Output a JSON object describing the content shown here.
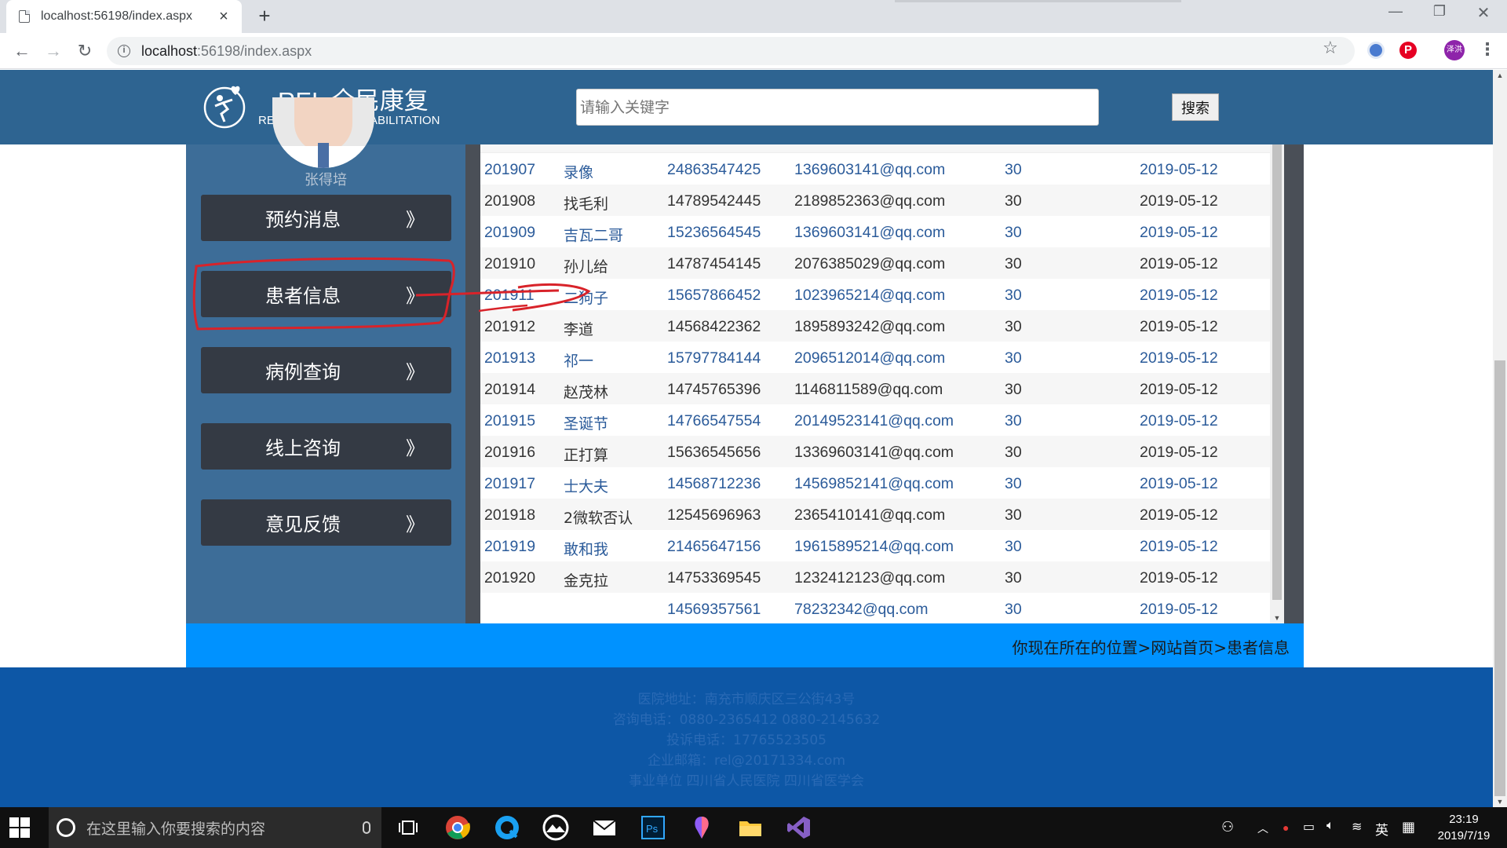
{
  "browser": {
    "tab_title": "localhost:56198/index.aspx",
    "tab_close": "×",
    "new_tab": "+",
    "url_host": "localhost",
    "url_path": ":56198/index.aspx",
    "window_min": "—",
    "window_max": "❐",
    "window_close": "✕",
    "profile_initials": "泽洪"
  },
  "header": {
    "title": "REL 全民康复",
    "subtitle": "REL NATIONAL REHABILITATION",
    "search_placeholder": "请输入关键字",
    "search_button": "搜索",
    "bg_color": "#2e6491"
  },
  "sidebar": {
    "username": "张得培",
    "chevron": "》",
    "items": [
      {
        "label": "预约消息"
      },
      {
        "label": "患者信息"
      },
      {
        "label": "病例查询"
      },
      {
        "label": "线上咨询"
      },
      {
        "label": "意见反馈"
      }
    ]
  },
  "table": {
    "rows": [
      {
        "id": "201907",
        "name": "录像",
        "phone": "24863547425",
        "email": "1369603141@qq.com",
        "age": "30",
        "date": "2019-05-12"
      },
      {
        "id": "201908",
        "name": "找毛利",
        "phone": "14789542445",
        "email": "2189852363@qq.com",
        "age": "30",
        "date": "2019-05-12"
      },
      {
        "id": "201909",
        "name": "吉瓦二哥",
        "phone": "15236564545",
        "email": "1369603141@qq.com",
        "age": "30",
        "date": "2019-05-12"
      },
      {
        "id": "201910",
        "name": "孙儿给",
        "phone": "14787454145",
        "email": "2076385029@qq.com",
        "age": "30",
        "date": "2019-05-12"
      },
      {
        "id": "201911",
        "name": "二狗子",
        "phone": "15657866452",
        "email": "1023965214@qq.com",
        "age": "30",
        "date": "2019-05-12"
      },
      {
        "id": "201912",
        "name": "李道",
        "phone": "14568422362",
        "email": "1895893242@qq.com",
        "age": "30",
        "date": "2019-05-12"
      },
      {
        "id": "201913",
        "name": "祁一",
        "phone": "15797784144",
        "email": "2096512014@qq.com",
        "age": "30",
        "date": "2019-05-12"
      },
      {
        "id": "201914",
        "name": "赵茂林",
        "phone": "14745765396",
        "email": "1146811589@qq.com",
        "age": "30",
        "date": "2019-05-12"
      },
      {
        "id": "201915",
        "name": "圣诞节",
        "phone": "14766547554",
        "email": "20149523141@qq.com",
        "age": "30",
        "date": "2019-05-12"
      },
      {
        "id": "201916",
        "name": "正打算",
        "phone": "15636545656",
        "email": "13369603141@qq.com",
        "age": "30",
        "date": "2019-05-12"
      },
      {
        "id": "201917",
        "name": "士大夫",
        "phone": "14568712236",
        "email": "14569852141@qq.com",
        "age": "30",
        "date": "2019-05-12"
      },
      {
        "id": "201918",
        "name": "2微软否认",
        "phone": "12545696963",
        "email": "2365410141@qq.com",
        "age": "30",
        "date": "2019-05-12"
      },
      {
        "id": "201919",
        "name": "敢和我",
        "phone": "21465647156",
        "email": "19615895214@qq.com",
        "age": "30",
        "date": "2019-05-12"
      },
      {
        "id": "201920",
        "name": "金克拉",
        "phone": "14753369545",
        "email": "1232412123@qq.com",
        "age": "30",
        "date": "2019-05-12"
      },
      {
        "id": "",
        "name": "",
        "phone": "14569357561",
        "email": "78232342@qq.com",
        "age": "30",
        "date": "2019-05-12"
      }
    ]
  },
  "breadcrumb": "你现在所在的位置>网站首页>患者信息",
  "footer": {
    "lines": [
      "医院地址：南充市顺庆区三公街43号",
      "咨询电话：0880-2365412 0880-2145632",
      "投诉电话：17765523505",
      "企业邮箱：rel@20171334.com",
      "事业单位 四川省人民医院 四川省医学会"
    ]
  },
  "taskbar": {
    "search_placeholder": "在这里输入你要搜索的内容",
    "ime": "英",
    "time": "23:19",
    "date": "2019/7/19"
  },
  "colors": {
    "accent_blue": "#0092ff",
    "sidebar_bg": "#3d6d98",
    "menu_btn": "#343a44",
    "footer_bg": "#0d57a6",
    "annotation_red": "#d8232a"
  }
}
